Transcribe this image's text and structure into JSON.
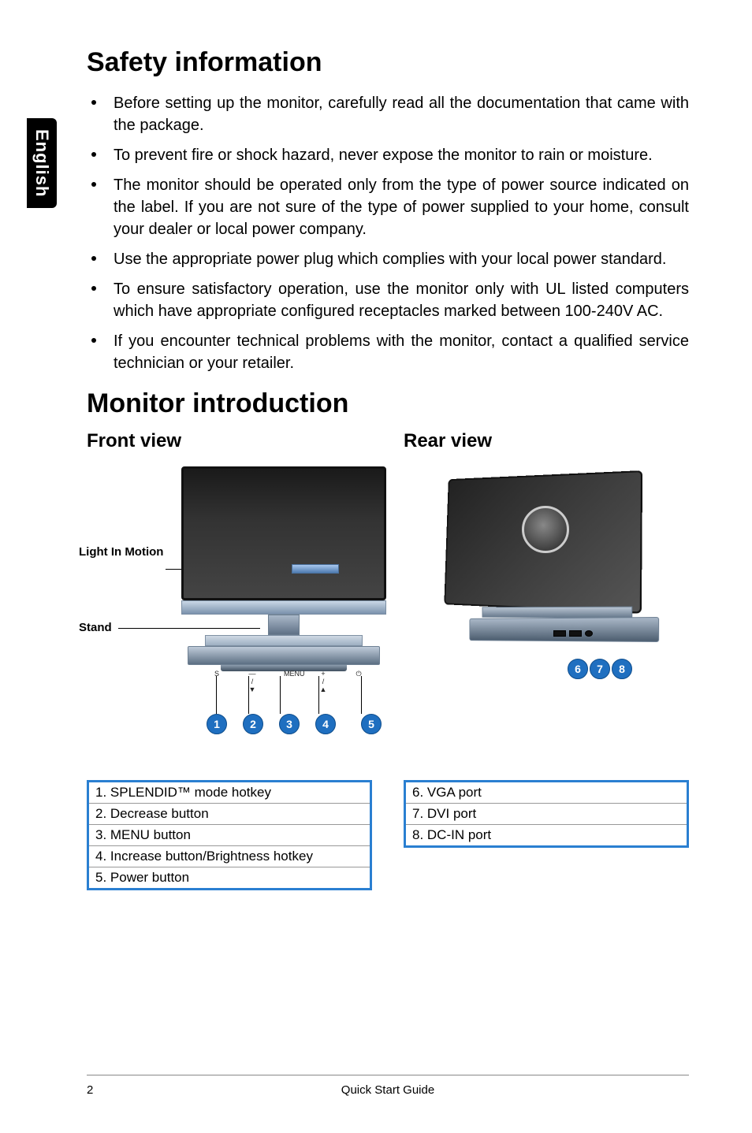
{
  "side_tab": "English",
  "h1_safety": "Safety information",
  "bullets": [
    "Before setting up the monitor, carefully read all the documentation that came with the package.",
    "To prevent fire or shock hazard, never expose the monitor to rain or moisture.",
    "The monitor should be operated only from the type of power source indicated on the label. If you are not sure of the type of power supplied to your home, consult your dealer or local power company.",
    "Use the appropriate power plug which complies with your local power standard.",
    "To ensure satisfactory operation, use the monitor only with UL listed  computers which have appropriate configured receptacles marked between 100-240V AC.",
    "If you encounter technical problems with the monitor, contact a qualified service technician or your retailer."
  ],
  "h2_intro": "Monitor introduction",
  "front_view_heading": "Front view",
  "rear_view_heading": "Rear view",
  "front_callouts": {
    "light_in_motion": "Light In Motion",
    "stand": "Stand"
  },
  "front_button_icons": {
    "b1": "S",
    "b2": "— / ▼",
    "b3": "MENU",
    "b4": "+ / ▲",
    "b5": "⏻"
  },
  "front_numbers": [
    "1",
    "2",
    "3",
    "4",
    "5"
  ],
  "rear_numbers": [
    "6",
    "7",
    "8"
  ],
  "legend_front": [
    "1. SPLENDID™ mode hotkey",
    "2. Decrease button",
    "3. MENU button",
    "4. Increase button/Brightness hotkey",
    "5. Power button"
  ],
  "legend_rear": [
    "6. VGA port",
    "7. DVI port",
    "8. DC-IN port"
  ],
  "footer": {
    "page": "2",
    "title": "Quick Start Guide"
  }
}
